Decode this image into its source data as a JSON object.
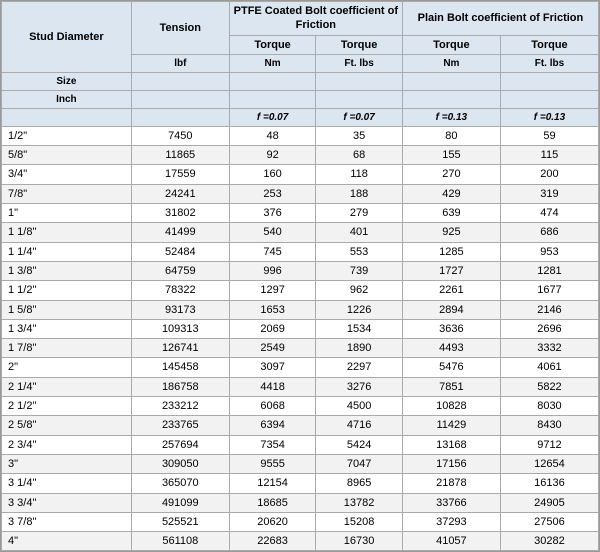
{
  "headers": {
    "stud_diameter": "Stud Diameter",
    "tension": "Tension",
    "ptfe_group": "PTFE Coated Bolt coefficient of Friction",
    "plain_group": "Plain Bolt coefficient of Friction",
    "size": "Size",
    "inch": "Inch",
    "lbf": "lbf",
    "torque": "Torque",
    "nm": "Nm",
    "ft_lbs": "Ft. lbs",
    "f007a": "f =0.07",
    "f007b": "f =0.07",
    "f013a": "f =0.13",
    "f013b": "f =0.13"
  },
  "rows": [
    [
      "1/2\"",
      "7450",
      "48",
      "35",
      "80",
      "59"
    ],
    [
      "5/8\"",
      "11865",
      "92",
      "68",
      "155",
      "115"
    ],
    [
      "3/4\"",
      "17559",
      "160",
      "118",
      "270",
      "200"
    ],
    [
      "7/8\"",
      "24241",
      "253",
      "188",
      "429",
      "319"
    ],
    [
      "1\"",
      "31802",
      "376",
      "279",
      "639",
      "474"
    ],
    [
      "1  1/8\"",
      "41499",
      "540",
      "401",
      "925",
      "686"
    ],
    [
      "1  1/4\"",
      "52484",
      "745",
      "553",
      "1285",
      "953"
    ],
    [
      "1  3/8\"",
      "64759",
      "996",
      "739",
      "1727",
      "1281"
    ],
    [
      "1  1/2\"",
      "78322",
      "1297",
      "962",
      "2261",
      "1677"
    ],
    [
      "1  5/8\"",
      "93173",
      "1653",
      "1226",
      "2894",
      "2146"
    ],
    [
      "1  3/4\"",
      "109313",
      "2069",
      "1534",
      "3636",
      "2696"
    ],
    [
      "1  7/8\"",
      "126741",
      "2549",
      "1890",
      "4493",
      "3332"
    ],
    [
      "2\"",
      "145458",
      "3097",
      "2297",
      "5476",
      "4061"
    ],
    [
      "2  1/4\"",
      "186758",
      "4418",
      "3276",
      "7851",
      "5822"
    ],
    [
      "2  1/2\"",
      "233212",
      "6068",
      "4500",
      "10828",
      "8030"
    ],
    [
      "2  5/8\"",
      "233765",
      "6394",
      "4716",
      "11429",
      "8430"
    ],
    [
      "2  3/4\"",
      "257694",
      "7354",
      "5424",
      "13168",
      "9712"
    ],
    [
      "3\"",
      "309050",
      "9555",
      "7047",
      "17156",
      "12654"
    ],
    [
      "3  1/4\"",
      "365070",
      "12154",
      "8965",
      "21878",
      "16136"
    ],
    [
      "3  3/4\"",
      "491099",
      "18685",
      "13782",
      "33766",
      "24905"
    ],
    [
      "3  7/8\"",
      "525521",
      "20620",
      "15208",
      "37293",
      "27506"
    ],
    [
      "4\"",
      "561108",
      "22683",
      "16730",
      "41057",
      "30282"
    ]
  ]
}
